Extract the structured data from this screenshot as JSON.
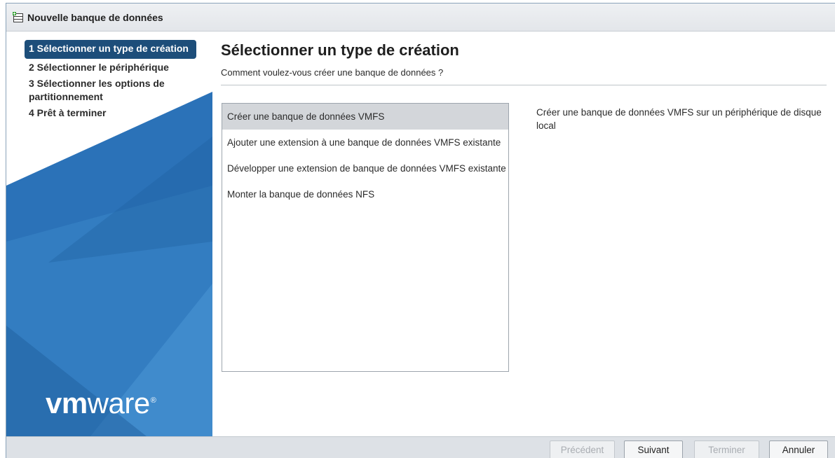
{
  "dialog": {
    "title": "Nouvelle banque de données",
    "title_icon": "datastore-add-icon"
  },
  "steps": [
    {
      "label": "1 Sélectionner un type de création",
      "active": true
    },
    {
      "label": "2 Sélectionner le périphérique",
      "active": false
    },
    {
      "label": "3 Sélectionner les options de partitionnement",
      "active": false
    },
    {
      "label": "4 Prêt à terminer",
      "active": false
    }
  ],
  "brand": {
    "logo_bold": "vm",
    "logo_rest": "ware",
    "logo_mark": "®"
  },
  "page": {
    "title": "Sélectionner un type de création",
    "subtitle": "Comment voulez-vous créer une banque de données ?"
  },
  "options": [
    {
      "label": "Créer une banque de données VMFS",
      "selected": true
    },
    {
      "label": "Ajouter une extension à une banque de données VMFS existante",
      "selected": false
    },
    {
      "label": "Développer une extension de banque de données VMFS existante",
      "selected": false
    },
    {
      "label": "Monter la banque de données NFS",
      "selected": false
    }
  ],
  "description": "Créer une banque de données VMFS sur un périphérique de disque local",
  "footer": {
    "prev": "Précédent",
    "next": "Suivant",
    "finish": "Terminer",
    "cancel": "Annuler"
  },
  "colors": {
    "accent": "#1d4e7a",
    "sidebar_blue": "#2a6fb4",
    "selected_row": "#d3d6da"
  }
}
